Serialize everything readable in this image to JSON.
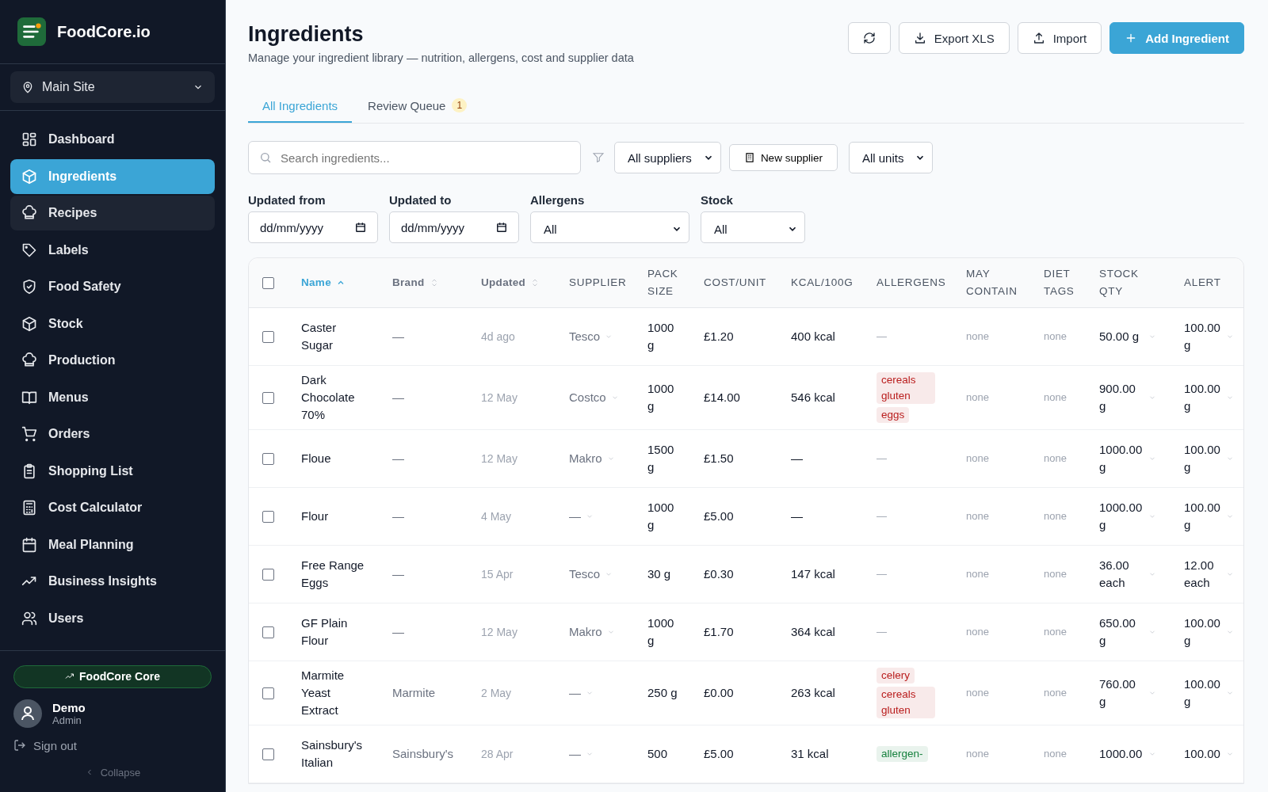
{
  "brand": {
    "name": "FoodCore.io"
  },
  "site_selector": {
    "value": "Main Site"
  },
  "nav": [
    {
      "label": "Dashboard",
      "selected": false,
      "hovered": false
    },
    {
      "label": "Ingredients",
      "selected": true,
      "hovered": false
    },
    {
      "label": "Recipes",
      "selected": false,
      "hovered": true
    },
    {
      "label": "Labels",
      "selected": false,
      "hovered": false
    },
    {
      "label": "Food Safety",
      "selected": false,
      "hovered": false
    },
    {
      "label": "Stock",
      "selected": false,
      "hovered": false
    },
    {
      "label": "Production",
      "selected": false,
      "hovered": false
    },
    {
      "label": "Menus",
      "selected": false,
      "hovered": false
    },
    {
      "label": "Orders",
      "selected": false,
      "hovered": false
    },
    {
      "label": "Shopping List",
      "selected": false,
      "hovered": false
    },
    {
      "label": "Cost Calculator",
      "selected": false,
      "hovered": false
    },
    {
      "label": "Meal Planning",
      "selected": false,
      "hovered": false
    },
    {
      "label": "Business Insights",
      "selected": false,
      "hovered": false
    },
    {
      "label": "Users",
      "selected": false,
      "hovered": false
    }
  ],
  "plan_button": {
    "label": "FoodCore Core"
  },
  "user": {
    "name": "Demo",
    "role": "Admin"
  },
  "sign_out": "Sign out",
  "collapse": "Collapse",
  "page": {
    "title": "Ingredients",
    "subtitle": "Manage your ingredient library — nutrition, allergens, cost and supplier data"
  },
  "actions": [
    {
      "kind": "refresh"
    },
    {
      "kind": "export",
      "label": "Export XLS"
    },
    {
      "kind": "import",
      "label": "Import"
    },
    {
      "kind": "add",
      "label": "Add Ingredient"
    }
  ],
  "tabs": [
    {
      "label": "All Ingredients",
      "selected": true
    },
    {
      "label": "Review Queue",
      "selected": false,
      "badge": "1"
    }
  ],
  "search": {
    "placeholder": "Search ingredients..."
  },
  "supplier_filter": {
    "value": "All suppliers"
  },
  "new_supplier": "New supplier",
  "unit_filter": {
    "value": "All units"
  },
  "filters": [
    {
      "label": "Updated from",
      "kind": "date",
      "value": "dd/mm/yyyy"
    },
    {
      "label": "Updated to",
      "kind": "date",
      "value": "dd/mm/yyyy"
    },
    {
      "label": "Allergens",
      "kind": "select",
      "value": "All"
    },
    {
      "label": "Stock",
      "kind": "select",
      "value": "All"
    }
  ],
  "table": {
    "select_all": false,
    "columns": [
      {
        "label": "Name",
        "sortable": true,
        "sorted": true
      },
      {
        "label": "Brand",
        "sortable": true,
        "sorted": false
      },
      {
        "label": "Updated",
        "sortable": true,
        "sorted": false
      },
      {
        "label": "SUPPLIER",
        "sortable": false,
        "sorted": false
      },
      {
        "label": "PACK SIZE",
        "sortable": false,
        "sorted": false
      },
      {
        "label": "COST/UNIT",
        "sortable": false,
        "sorted": false
      },
      {
        "label": "KCAL/100G",
        "sortable": false,
        "sorted": false
      },
      {
        "label": "ALLERGENS",
        "sortable": false,
        "sorted": false
      },
      {
        "label": "MAY CONTAIN",
        "sortable": false,
        "sorted": false
      },
      {
        "label": "DIET TAGS",
        "sortable": false,
        "sorted": false
      },
      {
        "label": "STOCK QTY",
        "sortable": false,
        "sorted": false
      },
      {
        "label": "ALERT",
        "sortable": false,
        "sorted": false
      }
    ],
    "rows": [
      {
        "checked": false,
        "name": "Caster Sugar",
        "brand": "—",
        "updated": "4d ago",
        "supplier": "Tesco",
        "pack": "1000 g",
        "cost": "£1.20",
        "kcal": "400 kcal",
        "allergens_empty": "—",
        "allergens": [],
        "may_contain": "none",
        "diet_tags": "none",
        "stock": "50.00 g",
        "alert": "100.00 g"
      },
      {
        "checked": false,
        "name": "Dark Chocolate 70%",
        "brand": "—",
        "updated": "12 May",
        "supplier": "Costco",
        "pack": "1000 g",
        "cost": "£14.00",
        "kcal": "546 kcal",
        "allergens": [
          {
            "label": "cereals gluten",
            "color": "#b91c1c"
          },
          {
            "label": "eggs",
            "color": "#b91c1c"
          }
        ],
        "may_contain": "none",
        "diet_tags": "none",
        "stock": "900.00 g",
        "alert": "100.00 g"
      },
      {
        "checked": false,
        "name": "Floue",
        "brand": "—",
        "updated": "12 May",
        "supplier": "Makro",
        "pack": "1500 g",
        "cost": "£1.50",
        "kcal": "—",
        "allergens_empty": "—",
        "allergens": [],
        "may_contain": "none",
        "diet_tags": "none",
        "stock": "1000.00 g",
        "alert": "100.00 g"
      },
      {
        "checked": false,
        "name": "Flour",
        "brand": "—",
        "updated": "4 May",
        "supplier": "—",
        "pack": "1000 g",
        "cost": "£5.00",
        "kcal": "—",
        "allergens_empty": "—",
        "allergens": [],
        "may_contain": "none",
        "diet_tags": "none",
        "stock": "1000.00 g",
        "alert": "100.00 g"
      },
      {
        "checked": false,
        "name": "Free Range Eggs",
        "brand": "—",
        "updated": "15 Apr",
        "supplier": "Tesco",
        "pack": "30 g",
        "cost": "£0.30",
        "kcal": "147 kcal",
        "allergens_empty": "—",
        "allergens": [],
        "may_contain": "none",
        "diet_tags": "none",
        "stock": "36.00 each",
        "alert": "12.00 each"
      },
      {
        "checked": false,
        "name": "GF Plain Flour",
        "brand": "—",
        "updated": "12 May",
        "supplier": "Makro",
        "pack": "1000 g",
        "cost": "£1.70",
        "kcal": "364 kcal",
        "allergens_empty": "—",
        "allergens": [],
        "may_contain": "none",
        "diet_tags": "none",
        "stock": "650.00 g",
        "alert": "100.00 g"
      },
      {
        "checked": false,
        "name": "Marmite Yeast Extract",
        "brand": "Marmite",
        "updated": "2 May",
        "supplier": "—",
        "pack": "250 g",
        "cost": "£0.00",
        "kcal": "263 kcal",
        "allergens": [
          {
            "label": "celery",
            "color": "#b91c1c"
          },
          {
            "label": "cereals gluten",
            "color": "#b91c1c"
          }
        ],
        "may_contain": "none",
        "diet_tags": "none",
        "stock": "760.00 g",
        "alert": "100.00 g"
      },
      {
        "checked": false,
        "name": "Sainsbury's Italian",
        "brand": "Sainsbury's",
        "updated": "28 Apr",
        "supplier": "—",
        "pack": "500",
        "cost": "£5.00",
        "kcal": "31 kcal",
        "allergens": [
          {
            "label": "allergen-",
            "color": "#15803d"
          }
        ],
        "may_contain": "none",
        "diet_tags": "none",
        "stock": "1000.00",
        "alert": "100.00"
      }
    ]
  }
}
